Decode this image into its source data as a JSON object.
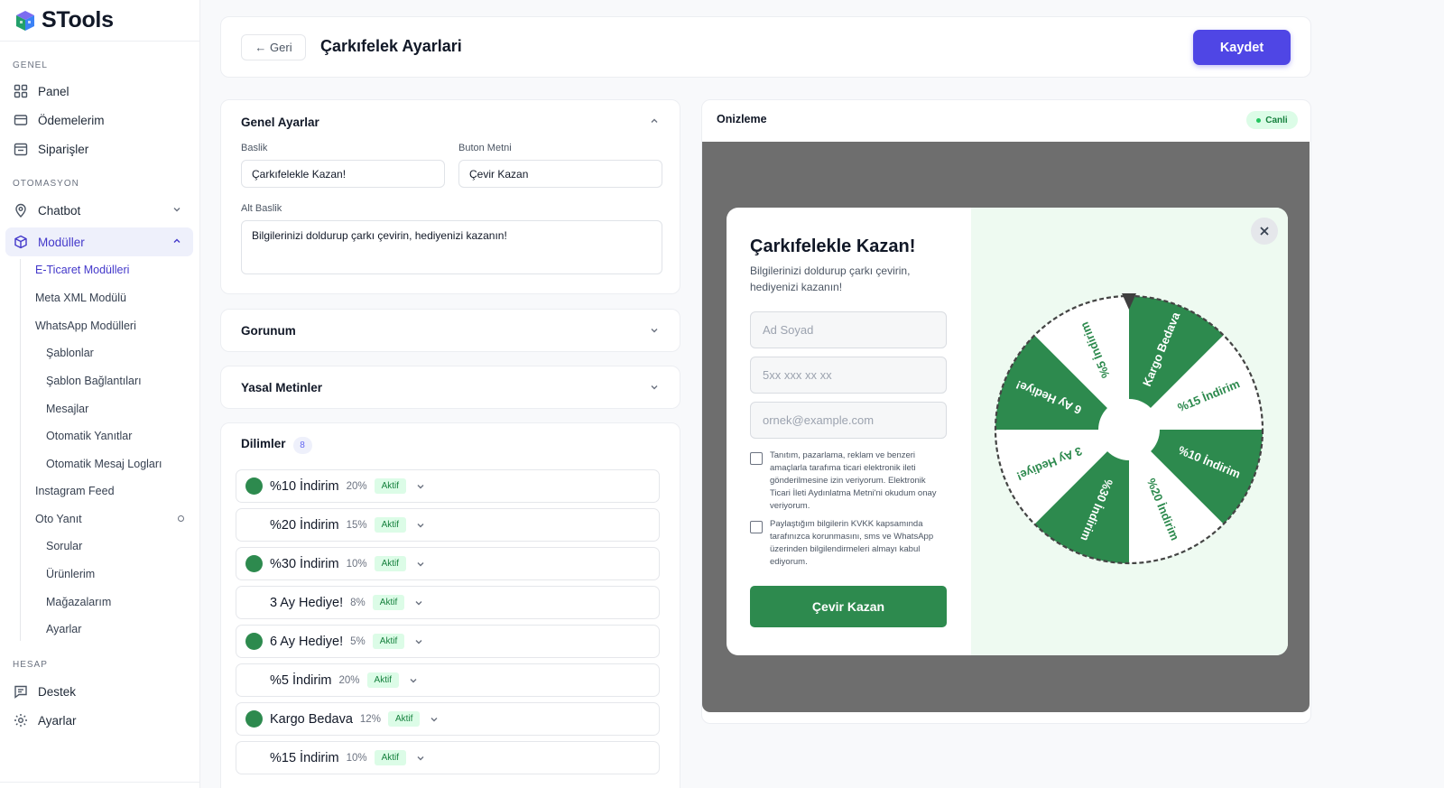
{
  "app": {
    "name": "STools"
  },
  "sidebar": {
    "sections": {
      "genel": "GENEL",
      "otomasyon": "OTOMASYON",
      "hesap": "HESAP"
    },
    "items": {
      "panel": "Panel",
      "odemelerim": "Ödemelerim",
      "siparisler": "Siparişler",
      "chatbot": "Chatbot",
      "moduller": "Modüller",
      "destek": "Destek",
      "ayarlar": "Ayarlar"
    },
    "sub_items": {
      "eticaret": "E-Ticaret Modülleri",
      "metaxml": "Meta XML Modülü",
      "whatsapp": "WhatsApp Modülleri",
      "sablonlar": "Şablonlar",
      "sablon_baglantilari": "Şablon Bağlantıları",
      "mesajlar": "Mesajlar",
      "otomatik_yanitlar": "Otomatik Yanıtlar",
      "otomatik_mesaj_loglari": "Otomatik Mesaj Logları",
      "instagram_feed": "Instagram Feed",
      "oto_yanit": "Oto Yanıt",
      "sorular": "Sorular",
      "urunlerim": "Ürünlerim",
      "magazalarim": "Mağazalarım",
      "ayarlar": "Ayarlar"
    }
  },
  "header": {
    "back_label": "← Geri",
    "title": "Çarkıfelek Ayarlari",
    "save_label": "Kaydet"
  },
  "general": {
    "title": "Genel Ayarlar",
    "baslik_label": "Baslik",
    "baslik_value": "Çarkıfelekle Kazan!",
    "buton_label": "Buton Metni",
    "buton_value": "Çevir Kazan",
    "alt_label": "Alt Baslik",
    "alt_value": "Bilgilerinizi doldurup çarkı çevirin, hediyenizi kazanın!"
  },
  "gorunum": {
    "title": "Gorunum"
  },
  "yasal": {
    "title": "Yasal Metinler"
  },
  "dilimler": {
    "title": "Dilimler",
    "count": "8",
    "rows": [
      {
        "label": "%10 İndirim",
        "pct": "20%",
        "status": "Aktif",
        "dot": true
      },
      {
        "label": "%20 İndirim",
        "pct": "15%",
        "status": "Aktif",
        "dot": false
      },
      {
        "label": "%30 İndirim",
        "pct": "10%",
        "status": "Aktif",
        "dot": true
      },
      {
        "label": "3 Ay Hediye!",
        "pct": "8%",
        "status": "Aktif",
        "dot": false
      },
      {
        "label": "6 Ay Hediye!",
        "pct": "5%",
        "status": "Aktif",
        "dot": true
      },
      {
        "label": "%5 İndirim",
        "pct": "20%",
        "status": "Aktif",
        "dot": false
      },
      {
        "label": "Kargo Bedava",
        "pct": "12%",
        "status": "Aktif",
        "dot": true
      },
      {
        "label": "%15 İndirim",
        "pct": "10%",
        "status": "Aktif",
        "dot": false
      }
    ]
  },
  "preview": {
    "title": "Onizleme",
    "live": "Canli",
    "modal": {
      "title": "Çarkıfelekle Kazan!",
      "subtitle": "Bilgilerinizi doldurup çarkı çevirin, hediyenizi kazanın!",
      "name_placeholder": "Ad Soyad",
      "phone_placeholder": "5xx xxx xx xx",
      "email_placeholder": "ornek@example.com",
      "consent1": "Tanıtım, pazarlama, reklam ve benzeri amaçlarla tarafıma ticari elektronik ileti gönderilmesine izin veriyorum. Elektronik Ticari İleti Aydınlatma Metni'ni okudum onay veriyorum.",
      "consent2": "Paylaştığım bilgilerin KVKK kapsamında tarafınızca korunmasını, sms ve WhatsApp üzerinden bilgilendirmeleri almayı kabul ediyorum.",
      "button": "Çevir Kazan"
    },
    "wheel_segments": [
      "Kargo Bedava",
      "%15 İndirim",
      "%10 İndirim",
      "%20 İndirim",
      "%30 İndirim",
      "3 Ay Hediye!",
      "6 Ay Hediye!",
      "%5 İndirim"
    ]
  },
  "colors": {
    "primary": "#4f46e5",
    "green": "#2d8a4e",
    "preview_bg": "#6e6e6e",
    "badge_green": "#dcfce7"
  }
}
